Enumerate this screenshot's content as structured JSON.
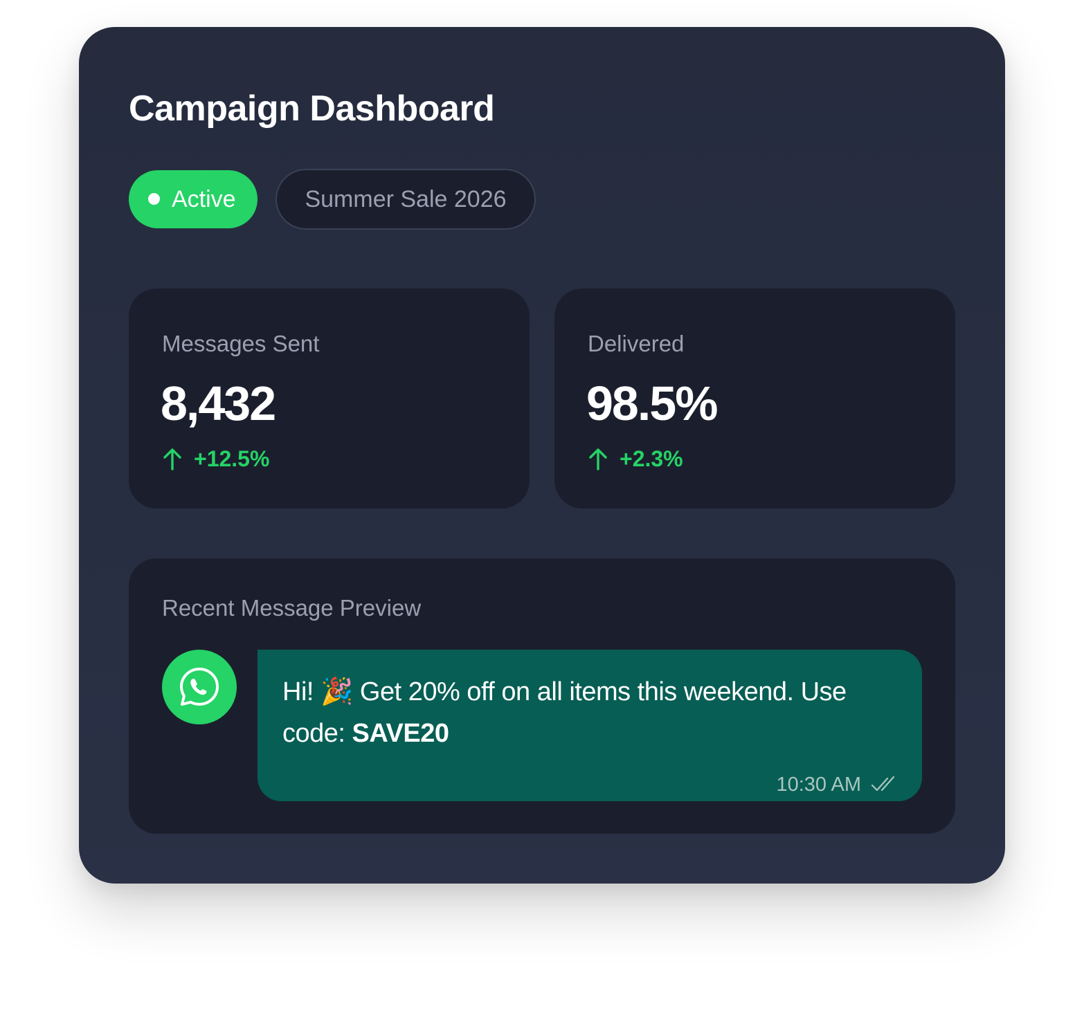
{
  "header": {
    "title": "Campaign Dashboard"
  },
  "status": {
    "active_label": "Active",
    "campaign_name": "Summer Sale 2026"
  },
  "stats": [
    {
      "label": "Messages Sent",
      "value": "8,432",
      "change": "+12.5%",
      "trend_icon": "arrow-up-icon"
    },
    {
      "label": "Delivered",
      "value": "98.5%",
      "change": "+2.3%",
      "trend_icon": "arrow-up-icon"
    }
  ],
  "preview": {
    "label": "Recent Message Preview",
    "avatar_icon": "whatsapp-icon",
    "message_greeting": "Hi! ",
    "message_emoji": "🎉",
    "message_body": " Get 20% off on all items this weekend. Use code: ",
    "message_code": "SAVE20",
    "timestamp": "10:30 AM",
    "status_icon": "double-check-icon"
  },
  "colors": {
    "accent": "#25d366",
    "bubble": "#075e54",
    "card_background": "#262c3e",
    "panel_background": "#1b1f2d"
  }
}
